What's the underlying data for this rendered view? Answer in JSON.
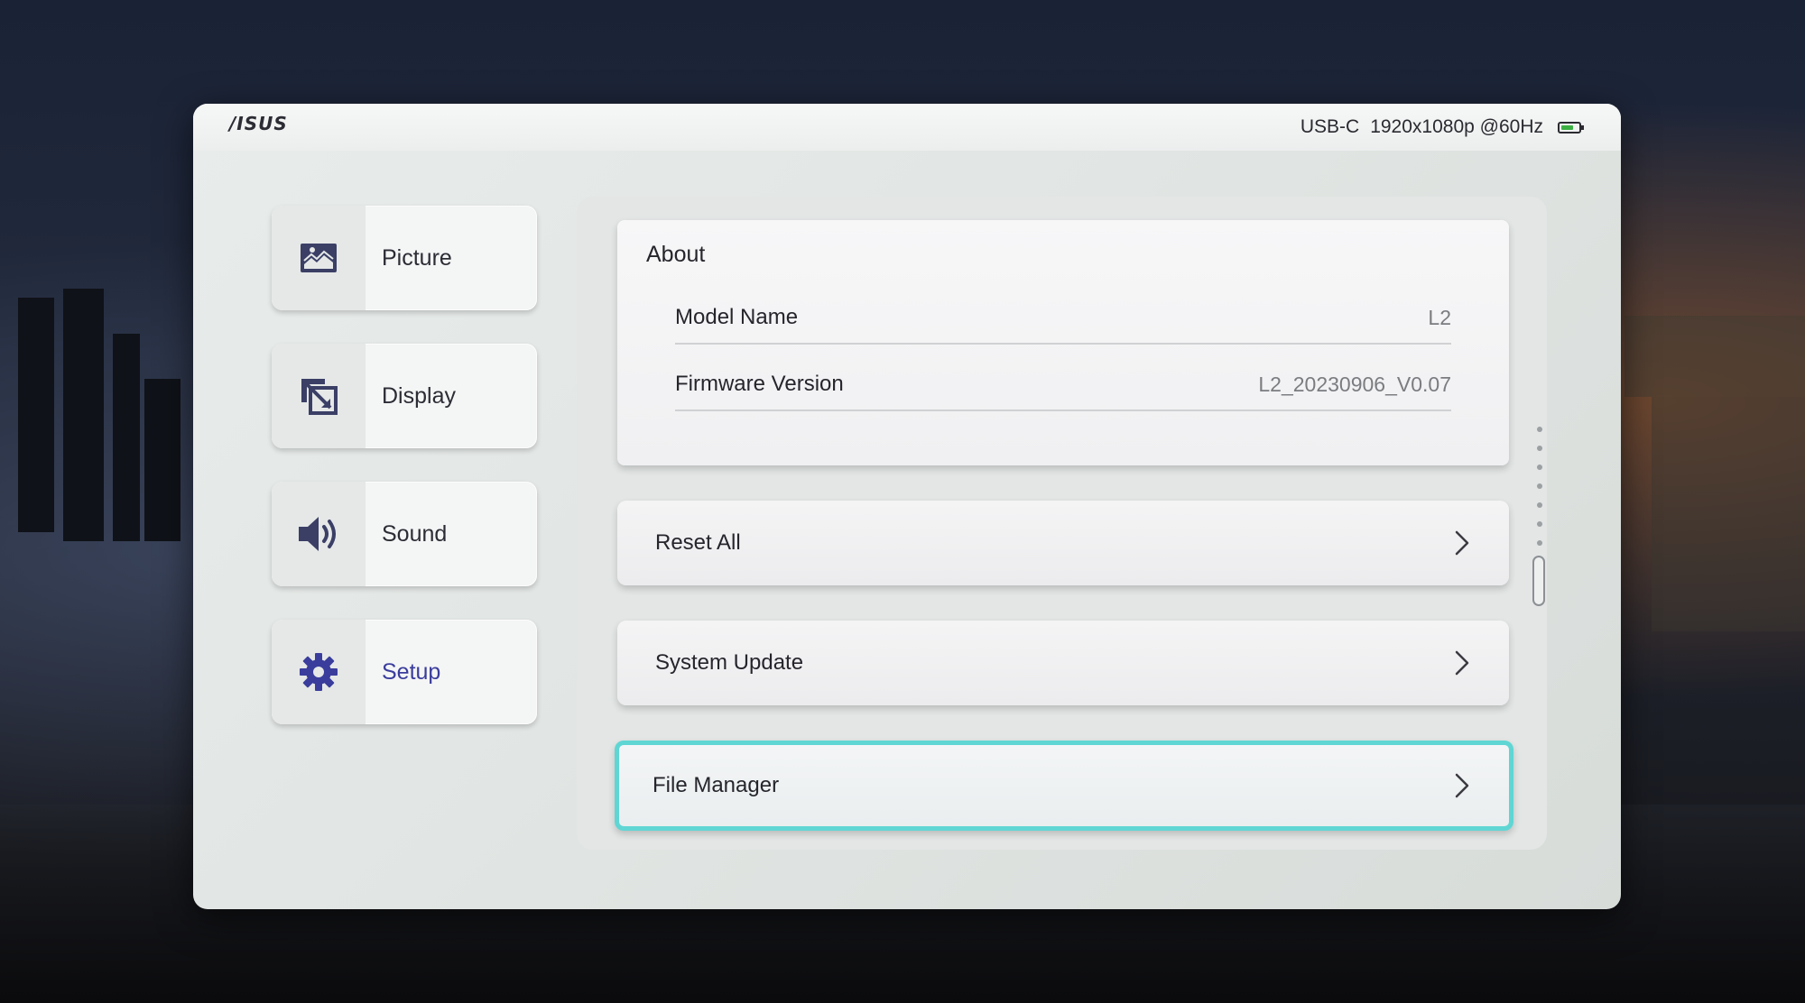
{
  "header": {
    "brand": "/ISUS",
    "input_source": "USB-C",
    "resolution": "1920x1080p @60Hz",
    "battery_icon": "battery-icon",
    "battery_level": 0.7,
    "battery_color": "#3cb043"
  },
  "sidebar": {
    "items": [
      {
        "label": "Picture",
        "icon": "picture-icon"
      },
      {
        "label": "Display",
        "icon": "display-icon"
      },
      {
        "label": "Sound",
        "icon": "sound-icon"
      },
      {
        "label": "Setup",
        "icon": "gear-icon",
        "active": true
      }
    ],
    "active_color": "#3a3d9c"
  },
  "about": {
    "title": "About",
    "rows": [
      {
        "key": "Model Name",
        "value": "L2"
      },
      {
        "key": "Firmware Version",
        "value": "L2_20230906_V0.07"
      }
    ]
  },
  "actions": [
    {
      "label": "Reset All",
      "icon": "chevron-right-icon"
    },
    {
      "label": "System Update",
      "icon": "chevron-right-icon"
    },
    {
      "label": "File Manager",
      "icon": "chevron-right-icon",
      "focused": true
    }
  ],
  "focus_color": "#5fd6d4"
}
